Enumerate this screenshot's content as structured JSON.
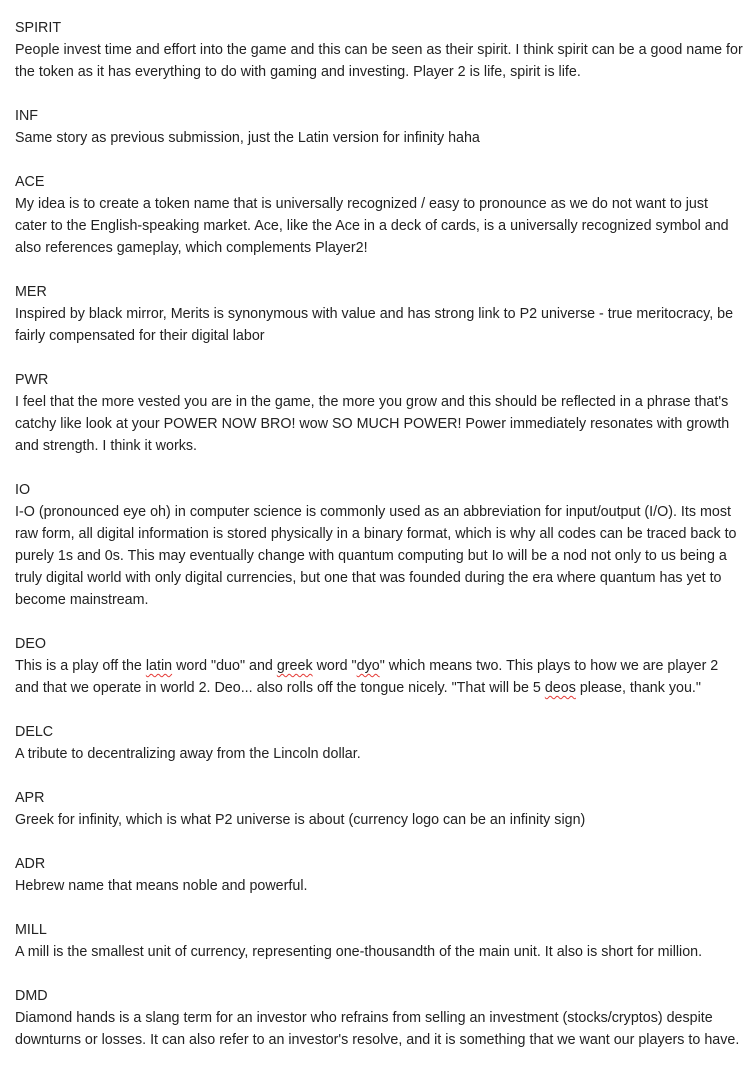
{
  "entries": [
    {
      "code": "SPIRIT",
      "text": "People invest time and effort into the game and this can be seen as their spirit. I think spirit can be a good name for the token as it has everything to do with gaming and investing. Player 2 is life, spirit is life."
    },
    {
      "code": "INF",
      "text": "Same story as previous submission, just the Latin version for infinity haha"
    },
    {
      "code": "ACE",
      "text": "My idea is to create a token name that is universally recognized / easy to pronounce as we do not want to just cater to the English-speaking market. Ace, like the Ace in a deck of cards, is a universally recognized symbol and also references gameplay, which complements Player2!"
    },
    {
      "code": "MER",
      "text": "Inspired by black mirror, Merits is synonymous with value and has strong link to P2 universe -  true meritocracy, be fairly compensated for their digital labor"
    },
    {
      "code": "PWR",
      "text": "I feel that the more vested you are in the game, the more you grow and this should be reflected in a phrase that's catchy like look at your POWER NOW BRO! wow SO MUCH POWER! Power immediately resonates with growth and strength. I think it works."
    },
    {
      "code": "IO",
      "text": "I-O (pronounced eye oh) in computer science is commonly used as an abbreviation for input/output (I/O). Its most raw form, all digital information is stored physically in a binary format, which is why all codes can be traced back to purely 1s and 0s. This may eventually change with quantum computing but Io will be a nod not only to us being a truly digital world with only digital currencies, but one that was founded during the era where quantum has yet to become mainstream."
    },
    {
      "code": "DEO",
      "text_parts": [
        "This is a play off the ",
        "latin",
        " word \"duo\" and ",
        "greek",
        " word \"",
        "dyo",
        "\" which means two. This plays to how we are player 2 and that we operate in world 2. Deo... also rolls off the tongue nicely. \"That will be 5 ",
        "deos",
        " please, thank you.\""
      ]
    },
    {
      "code": "DELC",
      "text": "A tribute to decentralizing away from the Lincoln dollar."
    },
    {
      "code": "APR",
      "text": "Greek for infinity, which is what P2 universe is about (currency logo can be an infinity sign)"
    },
    {
      "code": "ADR",
      "text": "Hebrew name that means noble and powerful."
    },
    {
      "code": "MILL",
      "text": "A mill is the smallest unit of currency, representing one-thousandth of the main unit. It also is short for million."
    },
    {
      "code": "DMD",
      "text": "Diamond hands is a slang term for an investor who refrains from selling an investment (stocks/cryptos) despite downturns or losses. It can also refer to an investor's resolve, and it is something that we want our players to have."
    }
  ],
  "colors": {
    "text": "#222222",
    "spellcheck_underline": "#e53935"
  }
}
